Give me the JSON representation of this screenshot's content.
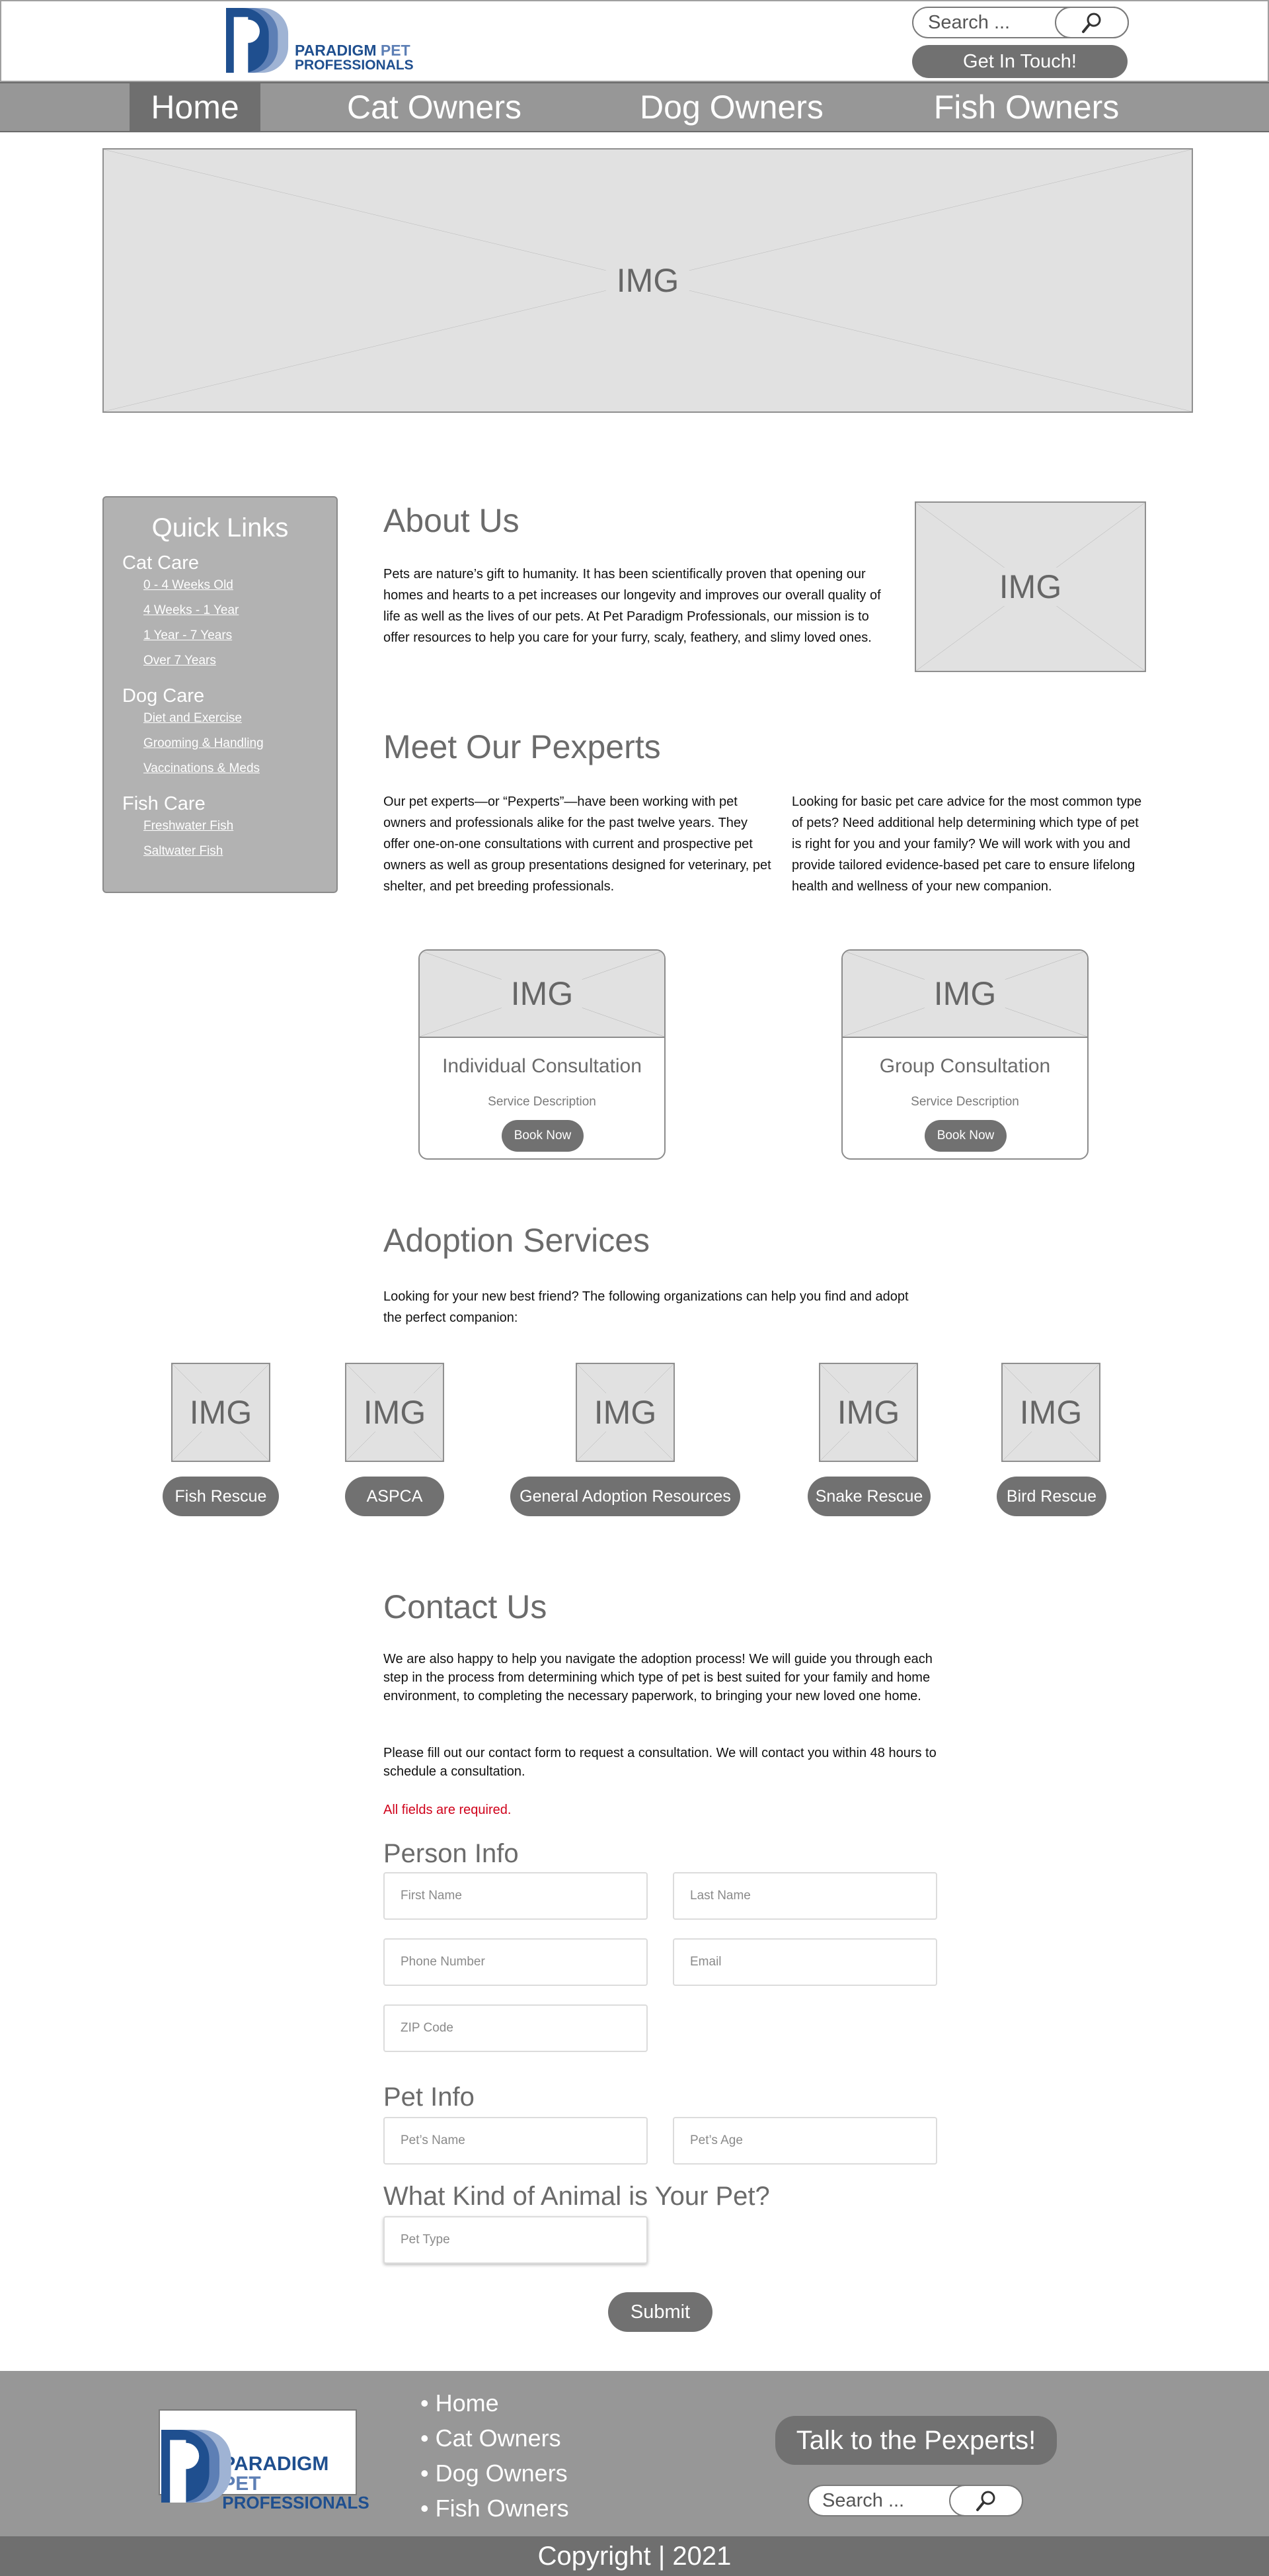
{
  "brand": {
    "line1_a": "PARADIGM",
    "line1_b": "PET",
    "line2": "PROFESSIONALS"
  },
  "header": {
    "search_placeholder": "Search ...",
    "cta_label": "Get In Touch!"
  },
  "nav": {
    "items": [
      "Home",
      "Cat Owners",
      "Dog Owners",
      "Fish Owners"
    ],
    "active": "Home"
  },
  "image_placeholder": "IMG",
  "sidebar": {
    "title": "Quick Links",
    "groups": [
      {
        "label": "Cat Care",
        "links": [
          "0 - 4 Weeks Old",
          "4 Weeks - 1 Year",
          "1 Year - 7 Years",
          "Over 7 Years"
        ]
      },
      {
        "label": "Dog Care",
        "links": [
          "Diet and Exercise",
          "Grooming & Handling",
          "Vaccinations & Meds"
        ]
      },
      {
        "label": "Fish Care",
        "links": [
          "Freshwater Fish",
          "Saltwater Fish"
        ]
      }
    ]
  },
  "about": {
    "title": "About Us",
    "body": "Pets are nature’s gift to humanity. It has been scientifically proven that opening our homes and hearts to a pet increases our longevity and improves our overall quality of life as well as the lives of our pets. At Pet Paradigm Professionals, our mission is to offer resources to help you care for your furry, scaly, feathery, and slimy loved ones."
  },
  "pexperts": {
    "title": "Meet Our Pexperts",
    "col1": "Our pet experts—or “Pexperts”—have been working with pet owners and professionals alike for the past twelve years. They offer one-on-one consultations with current and prospective pet owners as well as group presentations designed for veterinary, pet shelter, and pet breeding professionals.",
    "col2": "Looking for basic pet care advice for the most common type of pets? Need additional help determining which type of pet is right for you and your family? We will work with you and provide tailored evidence-based pet care to ensure lifelong health and wellness of your new companion.",
    "cards": [
      {
        "title": "Individual Consultation",
        "desc": "Service Description",
        "button": "Book Now"
      },
      {
        "title": "Group Consultation",
        "desc": "Service Description",
        "button": "Book Now"
      }
    ]
  },
  "adoption": {
    "title": "Adoption Services",
    "body": "Looking for your new best friend? The following organizations can help you find and adopt the perfect companion:",
    "orgs": [
      "Fish Rescue",
      "ASPCA",
      "General Adoption Resources",
      "Snake Rescue",
      "Bird Rescue"
    ]
  },
  "contact": {
    "title": "Contact Us",
    "p1": "We are also happy to help you navigate the adoption process! We will guide you through each step in the process from determining which type of pet is best suited for your family and home environment, to completing the necessary paperwork, to bringing your new loved one home.",
    "p2": "Please fill out our contact form to request a consultation. We will contact you within 48 hours to schedule a consultation.",
    "required": "All fields are required.",
    "required_color": "#d0021b",
    "person_heading": "Person Info",
    "pet_heading": "Pet Info",
    "animal_heading": "What Kind of Animal is Your Pet?",
    "fields": {
      "first_name": "First Name",
      "last_name": "Last Name",
      "phone": "Phone Number",
      "email": "Email",
      "zip": "ZIP Code",
      "pet_name": "Pet’s Name",
      "pet_age": "Pet’s Age",
      "pet_type": "Pet Type"
    },
    "submit": "Submit"
  },
  "footer": {
    "links": [
      "Home",
      "Cat Owners",
      "Dog Owners",
      "Fish Owners"
    ],
    "cta": "Talk to the Pexperts!",
    "search_placeholder": "Search ...",
    "copyright": "Copyright | 2021"
  }
}
